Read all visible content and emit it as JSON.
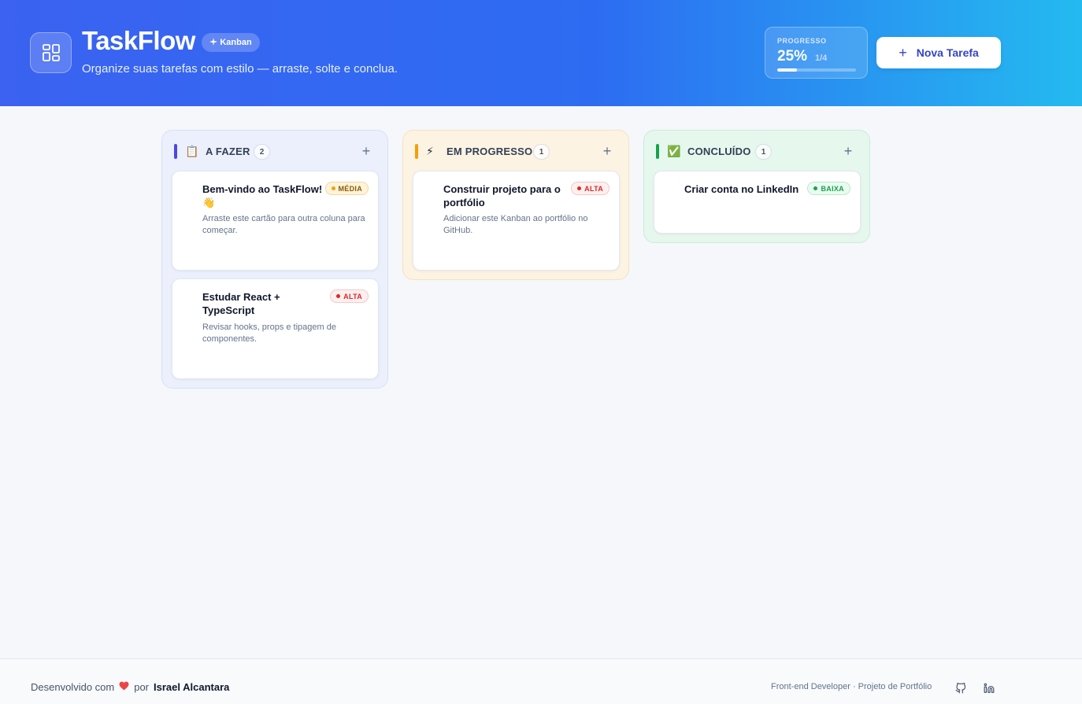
{
  "header": {
    "title": "TaskFlow",
    "badge": "Kanban",
    "subtitle": "Organize suas tarefas com estilo — arraste, solte e conclua.",
    "progress": {
      "label": "PROGRESSO",
      "percent": "25%",
      "count": "1/4",
      "fraction": 0.25
    },
    "new_task_label": "Nova Tarefa"
  },
  "columns": [
    {
      "title": "A FAZER",
      "count": "2",
      "emoji": "📋",
      "accent": "#4f46e5",
      "cards": [
        {
          "title": "Bem-vindo ao TaskFlow! 👋",
          "priority": "MÉDIA",
          "description": "Arraste este cartão para outra coluna para começar."
        },
        {
          "title": "Estudar React + TypeScript",
          "priority": "ALTA",
          "description": "Revisar hooks, props e tipagem de componentes."
        }
      ]
    },
    {
      "title": "EM PROGRESSO",
      "count": "1",
      "emoji": "⚡",
      "accent": "#f59e0b",
      "cards": [
        {
          "title": "Construir projeto para o portfólio",
          "priority": "ALTA",
          "description": "Adicionar este Kanban ao portfólio no GitHub."
        }
      ]
    },
    {
      "title": "CONCLUÍDO",
      "count": "1",
      "emoji": "✅",
      "accent": "#16a34a",
      "cards": [
        {
          "title": "Criar conta no LinkedIn",
          "priority": "BAIXA",
          "description": ""
        }
      ]
    }
  ],
  "footer": {
    "made_with": "Desenvolvido com",
    "by": "por",
    "author": "Israel Alcantara",
    "tagline": "Front-end Developer · Projeto de Portfólio"
  },
  "icons": {
    "logo": "layout-grid-icon",
    "badge": "sparkles-icon",
    "github": "github-icon",
    "linkedin": "linkedin-icon"
  }
}
